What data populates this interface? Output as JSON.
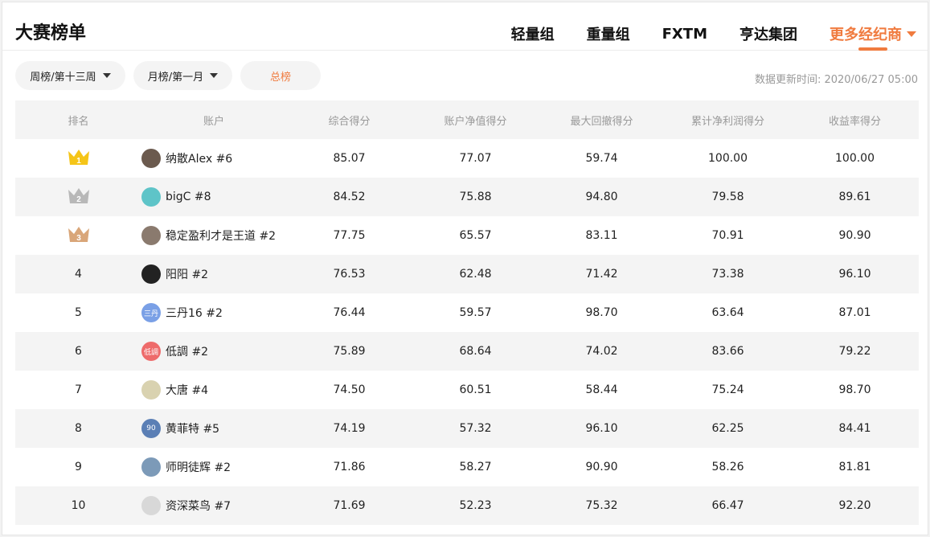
{
  "header": {
    "title": "大赛榜单",
    "tabs": [
      {
        "label": "轻量组"
      },
      {
        "label": "重量组"
      },
      {
        "label": "FXTM"
      },
      {
        "label": "亨达集团"
      },
      {
        "label": "更多经纪商"
      }
    ]
  },
  "filters": {
    "weekly": "周榜/第十三周",
    "monthly": "月榜/第一月",
    "total": "总榜"
  },
  "updated": "数据更新时间: 2020/06/27 05:00",
  "columns": [
    "排名",
    "账户",
    "综合得分",
    "账户净值得分",
    "最大回撤得分",
    "累计净利润得分",
    "收益率得分"
  ],
  "rows": [
    {
      "rank": "1",
      "account": "纳散Alex #6",
      "avatar_text": "",
      "avatar_color": "#6b5a4e",
      "c1": "85.07",
      "c2": "77.07",
      "c3": "59.74",
      "c4": "100.00",
      "c5": "100.00"
    },
    {
      "rank": "2",
      "account": "bigC #8",
      "avatar_text": "",
      "avatar_color": "#5ec4c8",
      "c1": "84.52",
      "c2": "75.88",
      "c3": "94.80",
      "c4": "79.58",
      "c5": "89.61"
    },
    {
      "rank": "3",
      "account": "稳定盈利才是王道 #2",
      "avatar_text": "",
      "avatar_color": "#8a7a6e",
      "c1": "77.75",
      "c2": "65.57",
      "c3": "83.11",
      "c4": "70.91",
      "c5": "90.90"
    },
    {
      "rank": "4",
      "account": "阳阳 #2",
      "avatar_text": "",
      "avatar_color": "#222222",
      "c1": "76.53",
      "c2": "62.48",
      "c3": "71.42",
      "c4": "73.38",
      "c5": "96.10"
    },
    {
      "rank": "5",
      "account": "三丹16 #2",
      "avatar_text": "三丹",
      "avatar_color": "#7aa0e6",
      "c1": "76.44",
      "c2": "59.57",
      "c3": "98.70",
      "c4": "63.64",
      "c5": "87.01"
    },
    {
      "rank": "6",
      "account": "低調 #2",
      "avatar_text": "低調",
      "avatar_color": "#ee6b6b",
      "c1": "75.89",
      "c2": "68.64",
      "c3": "74.02",
      "c4": "83.66",
      "c5": "79.22"
    },
    {
      "rank": "7",
      "account": "大唐 #4",
      "avatar_text": "",
      "avatar_color": "#d9d2b0",
      "c1": "74.50",
      "c2": "60.51",
      "c3": "58.44",
      "c4": "75.24",
      "c5": "98.70"
    },
    {
      "rank": "8",
      "account": "黄菲特 #5",
      "avatar_text": "90",
      "avatar_color": "#5b7fb5",
      "c1": "74.19",
      "c2": "57.32",
      "c3": "96.10",
      "c4": "62.25",
      "c5": "84.41"
    },
    {
      "rank": "9",
      "account": "师明徒辉 #2",
      "avatar_text": "",
      "avatar_color": "#7c9ab8",
      "c1": "71.86",
      "c2": "58.27",
      "c3": "90.90",
      "c4": "58.26",
      "c5": "81.81"
    },
    {
      "rank": "10",
      "account": "资深菜鸟 #7",
      "avatar_text": "",
      "avatar_color": "#d8d8d8",
      "c1": "71.69",
      "c2": "52.23",
      "c3": "75.32",
      "c4": "66.47",
      "c5": "92.20"
    }
  ],
  "crown_colors": {
    "1": "#f5c518",
    "2": "#b8b8b8",
    "3": "#d9a679"
  }
}
